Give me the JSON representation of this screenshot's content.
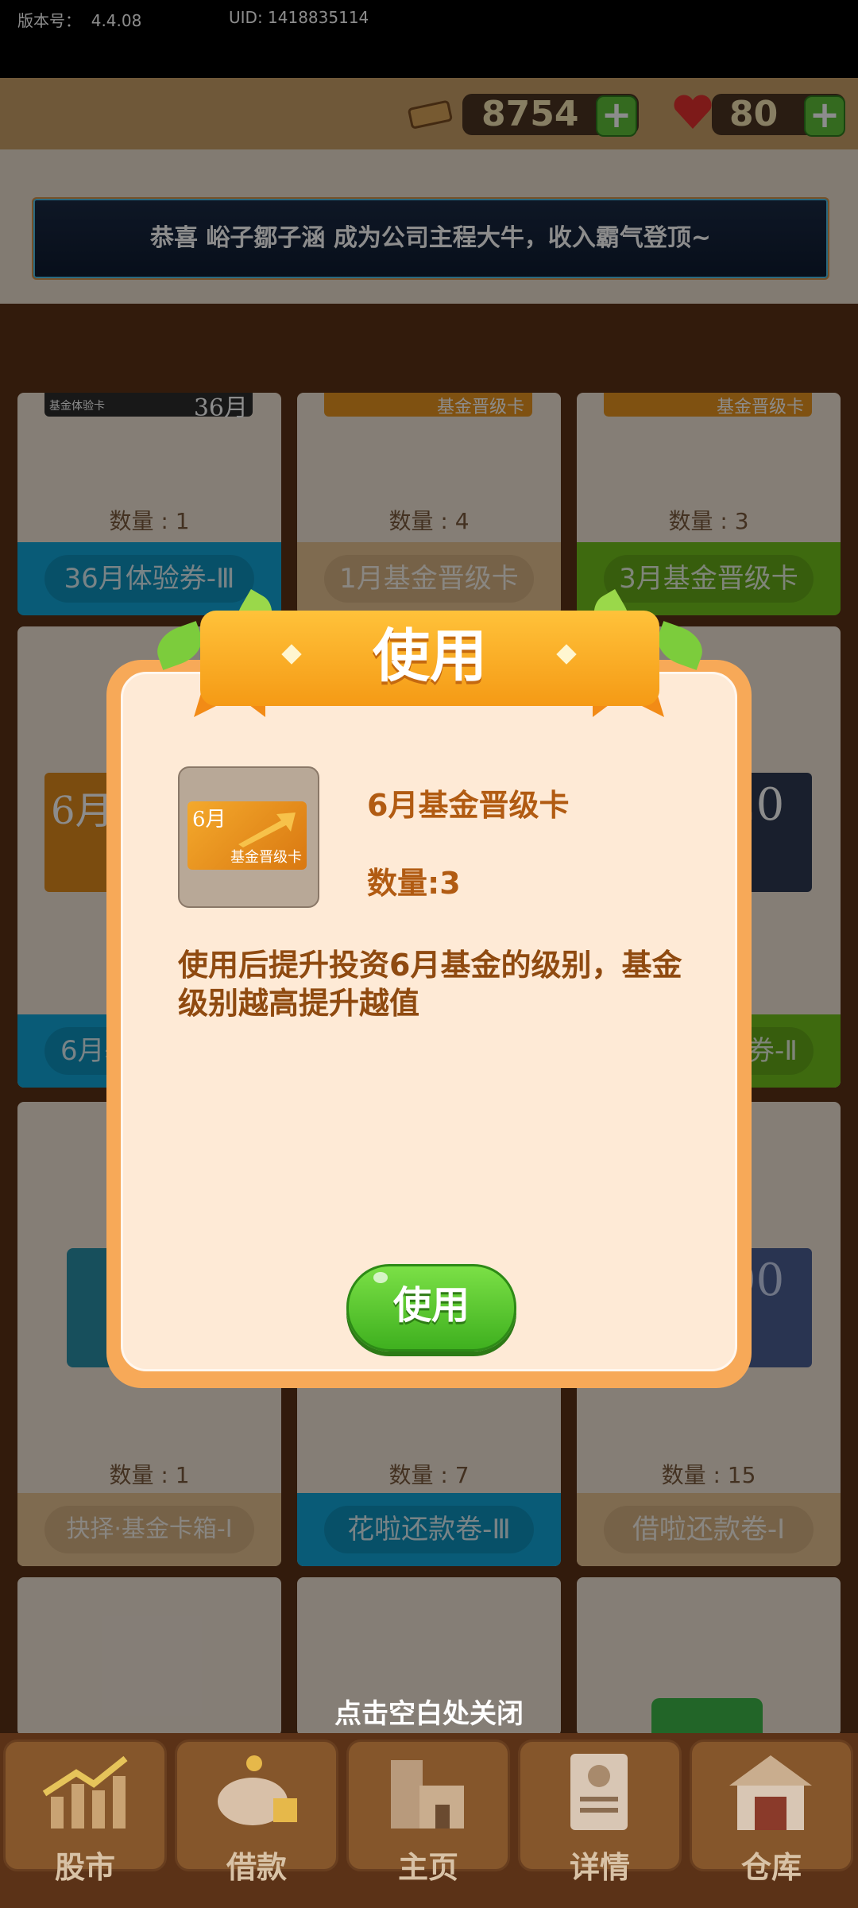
{
  "status": {
    "version_label": "版本号：",
    "version_value": "4.4.08",
    "uid": "UID: 1418835114"
  },
  "currency": {
    "cash_value": "8754",
    "hearts_value": "80",
    "plus_glyph": "+"
  },
  "banner": {
    "text": "恭喜 峪子鄒子涵 成为公司主程大牛，收入霸气登顶~"
  },
  "grid": {
    "cards_row1": [
      {
        "qty": "数量 : 1",
        "label": "36月体验券-Ⅲ",
        "strip_color": "#11a7d9",
        "thumb_text": "36月",
        "thumb_sub": "基金体验卡"
      },
      {
        "qty": "数量 : 4",
        "label": "1月基金晋级卡",
        "strip_color": "#e8c493",
        "thumb_sub": "基金晋级卡"
      },
      {
        "qty": "数量 : 3",
        "label": "3月基金晋级卡",
        "strip_color": "#72c21c",
        "thumb_sub": "基金晋级卡"
      }
    ],
    "cards_row2_visible": [
      {
        "label": "6月基",
        "thumb_text": "6月"
      },
      {
        "label": "券-Ⅱ",
        "thumb_text": "20"
      }
    ],
    "cards_row3": [
      {
        "qty": "数量 : 1",
        "label": "抉择·基金卡箱-Ⅰ",
        "strip_color": "#e8c493"
      },
      {
        "qty": "数量 : 7",
        "label": "花啦还款卷-Ⅲ",
        "strip_color": "#11a7d9"
      },
      {
        "qty": "数量 : 15",
        "label": "借啦还款卷-Ⅰ",
        "strip_color": "#e8c493",
        "thumb_text": "00"
      }
    ]
  },
  "dialog": {
    "title": "使用",
    "item_name": "6月基金晋级卡",
    "item_count": "数量:3",
    "thumb_month": "6月",
    "thumb_sub": "基金晋级卡",
    "description": "使用后提升投资6月基金的级别，基金级别越高提升越值",
    "use_button": "使用"
  },
  "close_hint": "点击空白处关闭",
  "nav": {
    "items": [
      {
        "label": "股市",
        "icon": "stock-chart-icon"
      },
      {
        "label": "借款",
        "icon": "piggy-bank-icon"
      },
      {
        "label": "主页",
        "icon": "home-icon"
      },
      {
        "label": "详情",
        "icon": "profile-card-icon"
      },
      {
        "label": "仓库",
        "icon": "warehouse-icon"
      }
    ]
  },
  "colors": {
    "accent_orange": "#f7a958",
    "button_green": "#3fb01f",
    "text_brown": "#b15b12",
    "background_brown": "#5b3217"
  }
}
